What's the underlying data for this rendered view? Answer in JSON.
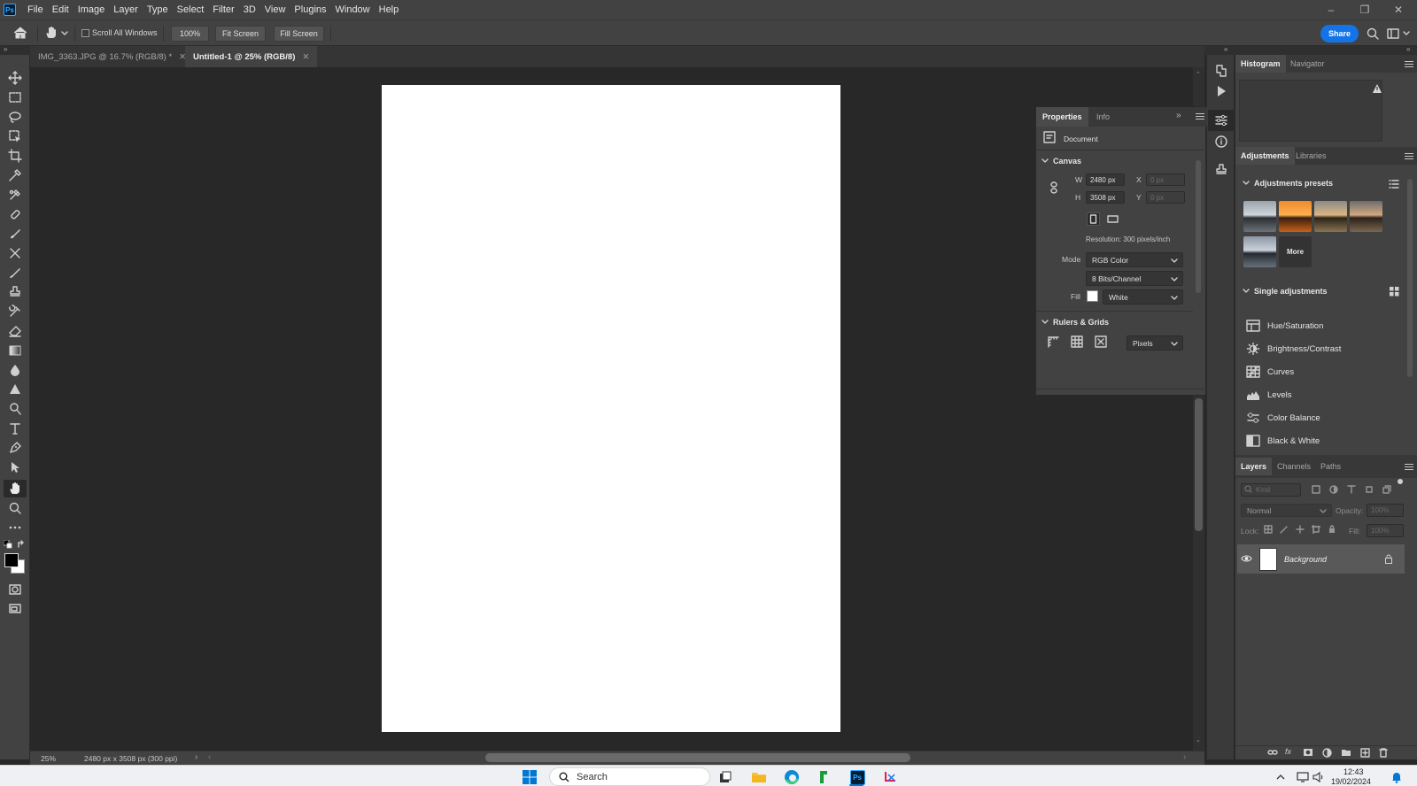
{
  "app": {
    "logo_text": "Ps",
    "menu": [
      "File",
      "Edit",
      "Image",
      "Layer",
      "Type",
      "Select",
      "Filter",
      "3D",
      "View",
      "Plugins",
      "Window",
      "Help"
    ]
  },
  "options_bar": {
    "scroll_all_windows": "Scroll All Windows",
    "zoom_100": "100%",
    "fit_screen": "Fit Screen",
    "fill_screen": "Fill Screen",
    "share": "Share"
  },
  "tabs": [
    {
      "label": "IMG_3363.JPG @ 16.7% (RGB/8) *",
      "active": false
    },
    {
      "label": "Untitled-1 @ 25% (RGB/8)",
      "active": true
    }
  ],
  "status": {
    "zoom": "25%",
    "doc_info": "2480 px x 3508 px (300 ppi)"
  },
  "properties": {
    "tabs": [
      "Properties",
      "Info"
    ],
    "document_label": "Document",
    "canvas_header": "Canvas",
    "w_label": "W",
    "h_label": "H",
    "x_label": "X",
    "y_label": "Y",
    "width": "2480 px",
    "height": "3508 px",
    "x_placeholder": "0 px",
    "y_placeholder": "0 px",
    "resolution": "Resolution: 300 pixels/inch",
    "mode_label": "Mode",
    "mode": "RGB Color",
    "bits": "8 Bits/Channel",
    "fill_label": "Fill",
    "fill": "White",
    "rulers_header": "Rulers & Grids",
    "units": "Pixels"
  },
  "dock": {
    "top_tabs": [
      "Histogram",
      "Navigator"
    ],
    "adj_tabs": [
      "Adjustments",
      "Libraries"
    ],
    "presets_header": "Adjustments presets",
    "more_label": "More",
    "single_header": "Single adjustments",
    "adjustments": [
      "Hue/Saturation",
      "Brightness/Contrast",
      "Curves",
      "Levels",
      "Color Balance",
      "Black & White"
    ],
    "layer_tabs": [
      "Layers",
      "Channels",
      "Paths"
    ],
    "kind_placeholder": "Kind",
    "blend_mode": "Normal",
    "opacity_label": "Opacity:",
    "opacity": "100%",
    "lock_label": "Lock:",
    "fill_label": "Fill:",
    "fill": "100%",
    "layer_name": "Background"
  },
  "taskbar": {
    "search_placeholder": "Search",
    "time": "12:43",
    "date": "19/02/2024"
  },
  "colors": {
    "accent": "#1473e6",
    "ps_blue": "#31a8ff",
    "panel": "#424242",
    "canvas_bg": "#282828"
  }
}
